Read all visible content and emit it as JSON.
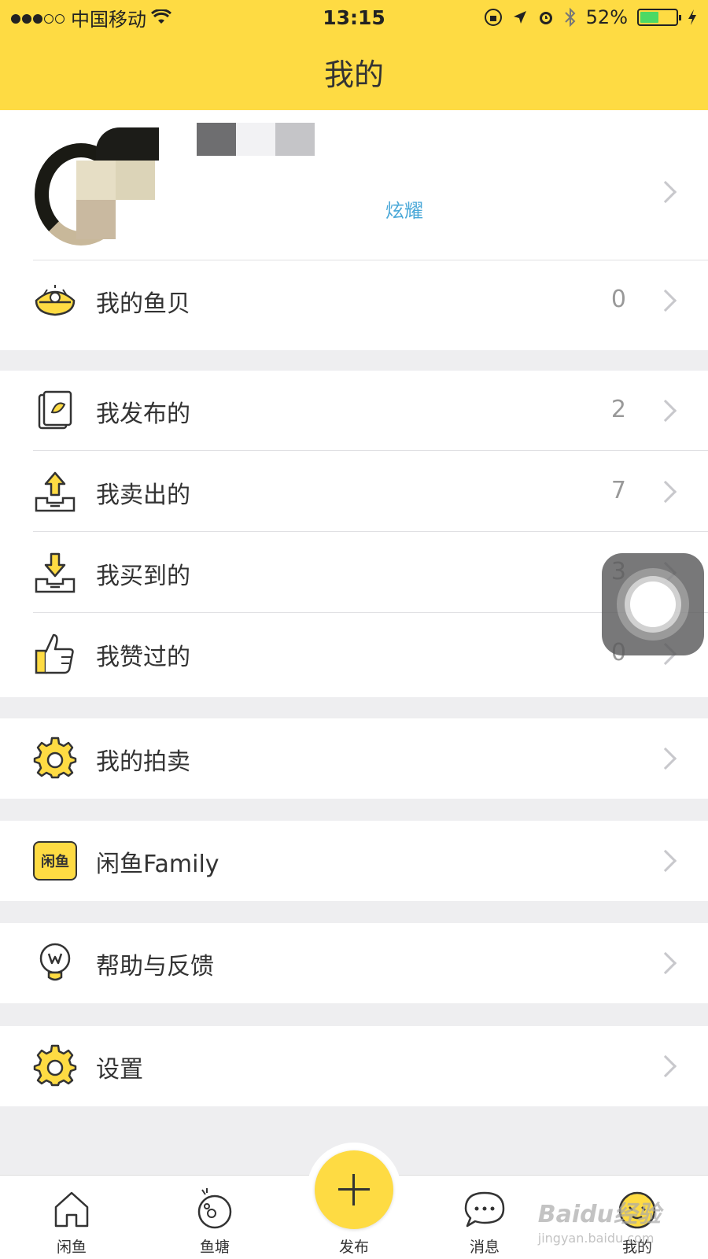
{
  "status_bar": {
    "carrier": "中国移动",
    "time": "13:15",
    "battery": "52%",
    "battery_level": 0.52
  },
  "header": {
    "title": "我的"
  },
  "profile": {
    "level_text": "炫耀"
  },
  "menu": {
    "shells": {
      "label": "我的鱼贝",
      "count": "0"
    },
    "published": {
      "label": "我发布的",
      "count": "2"
    },
    "sold": {
      "label": "我卖出的",
      "count": "7"
    },
    "bought": {
      "label": "我买到的",
      "count": "3"
    },
    "liked": {
      "label": "我赞过的",
      "count": "0"
    },
    "auction": {
      "label": "我的拍卖"
    },
    "family": {
      "label": "闲鱼Family",
      "icon_text": "闲鱼"
    },
    "help": {
      "label": "帮助与反馈"
    },
    "settings": {
      "label": "设置"
    }
  },
  "tabbar": {
    "home": "闲鱼",
    "pond": "鱼塘",
    "publish": "发布",
    "messages": "消息",
    "mine": "我的"
  },
  "watermark": {
    "brand": "Baidu经验",
    "url": "jingyan.baidu.com"
  },
  "colors": {
    "accent": "#fedb43",
    "link": "#4aa8d8",
    "count": "#999999"
  }
}
